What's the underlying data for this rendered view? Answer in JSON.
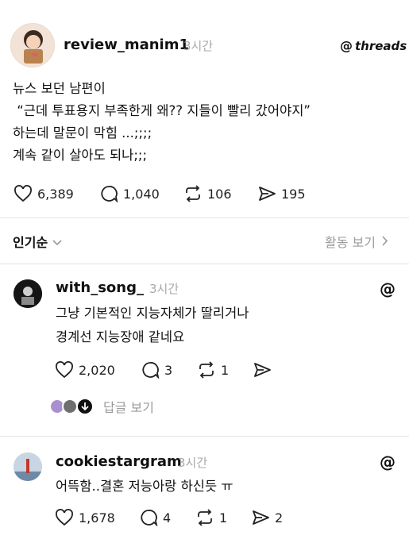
{
  "post": {
    "username": "review_manim1",
    "time": "3시간",
    "brand": "threads",
    "lines": [
      "뉴스 보던 남편이",
      " “근데 투표용지 부족한게 왜?? 지들이 빨리 갔어야지”",
      "하는데 말문이 막힘 ...;;;;",
      "계속 같이 살아도 되나;;;"
    ],
    "likes": "6,389",
    "comments": "1,040",
    "reposts": "106",
    "shares": "195"
  },
  "sort_bar": {
    "sort_label": "인기순",
    "activity_label": "활동 보기"
  },
  "replies": [
    {
      "username": "with_song_",
      "time": "3시간",
      "lines": [
        "그냥 기본적인 지능자체가 딸리거나",
        "경계선 지능장애 같네요"
      ],
      "likes": "2,020",
      "comments": "3",
      "reposts": "1",
      "shares": "",
      "view_replies": "답글 보기"
    },
    {
      "username": "cookiestargram",
      "time": "3시간",
      "lines": [
        "어뜩함..결혼 저능아랑 하신듯 ㅠ"
      ],
      "likes": "1,678",
      "comments": "4",
      "reposts": "1",
      "shares": "2"
    }
  ],
  "colors": {
    "text": "#111111",
    "muted": "#9a9a9a",
    "divider": "#e4e4e4",
    "background": "#ffffff"
  }
}
